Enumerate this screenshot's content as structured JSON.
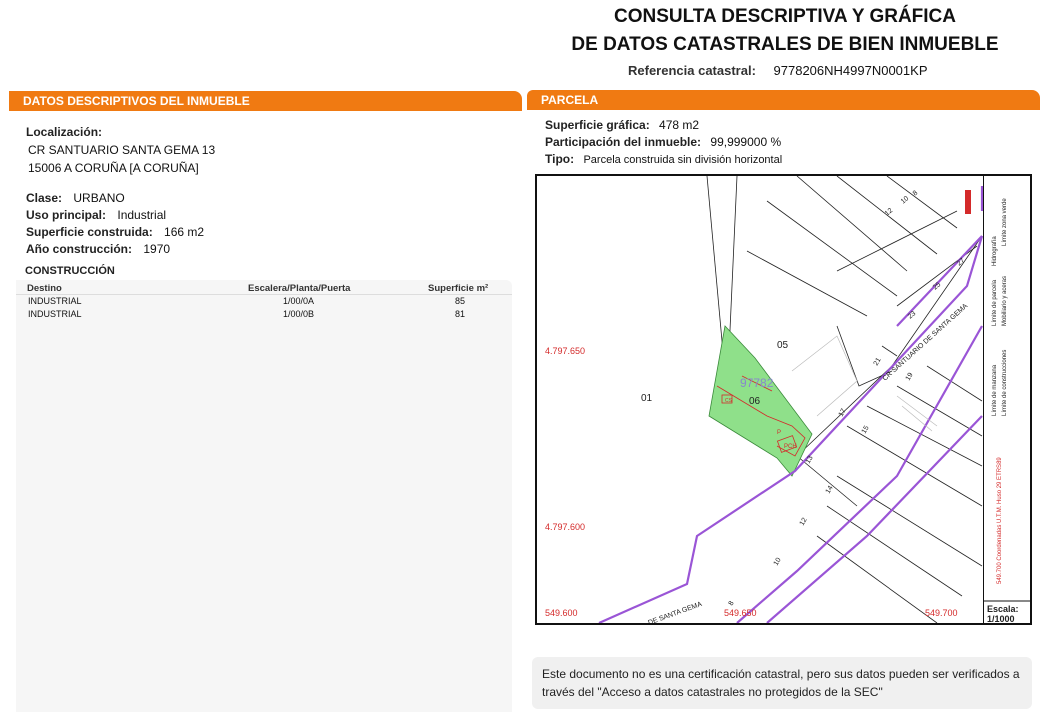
{
  "header": {
    "title_line1": "CONSULTA DESCRIPTIVA Y GRÁFICA",
    "title_line2": "DE DATOS CATASTRALES DE BIEN INMUEBLE",
    "ref_label": "Referencia catastral:",
    "ref_value": "9778206NH4997N0001KP"
  },
  "left_panel": {
    "band_title": "DATOS DESCRIPTIVOS DEL INMUEBLE",
    "localizacion_label": "Localización:",
    "address_line1": "CR SANTUARIO SANTA GEMA 13",
    "address_line2": "15006 A CORUÑA [A CORUÑA]",
    "clase_label": "Clase:",
    "clase_value": "URBANO",
    "uso_label": "Uso principal:",
    "uso_value": "Industrial",
    "superficie_label": "Superficie construida:",
    "superficie_value": "166 m2",
    "anio_label": "Año construcción:",
    "anio_value": "1970",
    "construccion_title": "CONSTRUCCIÓN",
    "table": {
      "headers": [
        "Destino",
        "Escalera/Planta/Puerta",
        "Superficie m²"
      ],
      "rows": [
        [
          "INDUSTRIAL",
          "1/00/0A",
          "85"
        ],
        [
          "INDUSTRIAL",
          "1/00/0B",
          "81"
        ]
      ]
    }
  },
  "right_panel": {
    "band_title": "PARCELA",
    "superficie_grafica_label": "Superficie gráfica:",
    "superficie_grafica_value": "478 m2",
    "participacion_label": "Participación del inmueble:",
    "participacion_value": "99,999000 %",
    "tipo_label": "Tipo:",
    "tipo_value": "Parcela construida sin división horizontal"
  },
  "map": {
    "coord_y1": "4.797.650",
    "coord_y2": "4.797.600",
    "coord_x1": "549.600",
    "coord_x2": "549.650",
    "coord_x3": "549.700",
    "parcel_ref": "97782",
    "parcel_06": "06",
    "parcel_05": "05",
    "parcel_01": "01",
    "street_label": "CR SANTUARIO DE SANTA GEMA",
    "street_label_bottom": "DE SANTA GEMA",
    "numbers": [
      "12",
      "10",
      "8",
      "23",
      "25",
      "27",
      "21",
      "19",
      "17",
      "15",
      "13",
      "14",
      "12",
      "10",
      "8"
    ],
    "bldg_labels": [
      "P",
      "PCH",
      "CS"
    ],
    "scale_label": "Escala:",
    "scale_value": "1/1000",
    "legend": {
      "limite_zona_verde": "Límite zona verde",
      "hidrografia": "Hidrografía",
      "limite_parcela": "Límite de parcela",
      "mobiliario": "Mobiliario y aceras",
      "limite_manzana": "Límite de manzana",
      "limite_construcciones": "Límite de construcciones",
      "coords": "549.700 Coordenadas U.T.M. Huso 29 ETRS89"
    },
    "colors": {
      "street": "#9a55d6",
      "parcel_fill": "#8fe08a",
      "red": "#d42a2a"
    }
  },
  "note": {
    "text": "Este documento no es una certificación catastral, pero sus datos pueden ser verificados a través del \"Acceso a datos catastrales no protegidos de la SEC\""
  }
}
